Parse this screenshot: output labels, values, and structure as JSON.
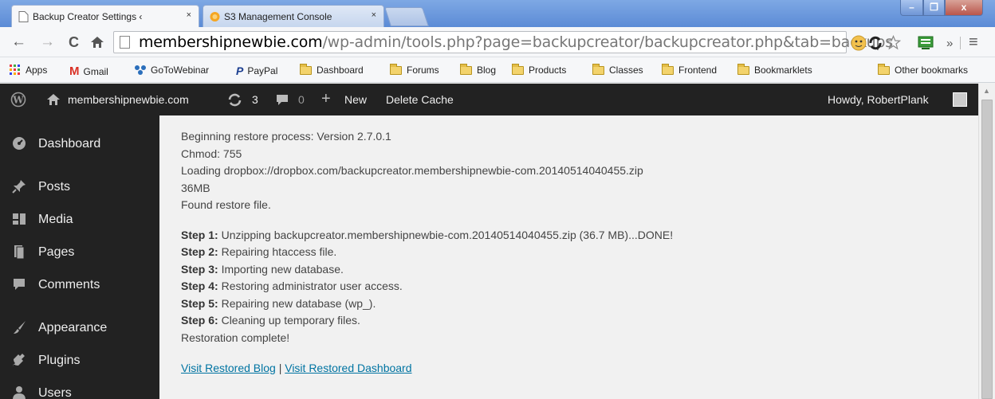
{
  "browser": {
    "tabs": [
      {
        "title": "Backup Creator Settings ‹",
        "close": "×"
      },
      {
        "title": "S3 Management Console",
        "close": "×"
      }
    ],
    "window_buttons": {
      "minimize": "–",
      "maximize": "❐",
      "close": "x"
    },
    "nav": {
      "back": "←",
      "forward": "→",
      "reload": "C",
      "home": "🏠"
    },
    "url": {
      "domain": "membershipnewbie.com",
      "path": "/wp-admin/tools.php?page=backupcreator/backupcreator.php&tab=backups"
    },
    "toolbar_right": {
      "overflow": "»",
      "menu": "≡"
    },
    "bookmarks": [
      {
        "label": "Apps",
        "icon": "apps-grid-icon"
      },
      {
        "label": "Gmail",
        "icon": "gmail-icon"
      },
      {
        "label": "GoToWebinar",
        "icon": "gotowebinar-icon"
      },
      {
        "label": "PayPal",
        "icon": "paypal-icon"
      },
      {
        "label": "Dashboard",
        "icon": "folder-icon"
      },
      {
        "label": "Forums",
        "icon": "folder-icon"
      },
      {
        "label": "Blog",
        "icon": "folder-icon"
      },
      {
        "label": "Products",
        "icon": "folder-icon"
      },
      {
        "label": "Classes",
        "icon": "folder-icon"
      },
      {
        "label": "Frontend",
        "icon": "folder-icon"
      },
      {
        "label": "Bookmarklets",
        "icon": "folder-icon"
      }
    ],
    "other_bookmarks": "Other bookmarks"
  },
  "adminbar": {
    "site": "membershipnewbie.com",
    "updates": "3",
    "comments": "0",
    "new": "New",
    "delete_cache": "Delete Cache",
    "howdy": "Howdy, RobertPlank"
  },
  "sidebar": {
    "items": [
      {
        "label": "Dashboard",
        "icon": "dashboard-icon"
      },
      {
        "label": "Posts",
        "icon": "pin-icon"
      },
      {
        "label": "Media",
        "icon": "media-icon"
      },
      {
        "label": "Pages",
        "icon": "pages-icon"
      },
      {
        "label": "Comments",
        "icon": "comment-icon"
      },
      {
        "label": "Appearance",
        "icon": "brush-icon"
      },
      {
        "label": "Plugins",
        "icon": "plugin-icon"
      },
      {
        "label": "Users",
        "icon": "users-icon"
      }
    ]
  },
  "log": {
    "intro": [
      "Beginning restore process: Version 2.7.0.1",
      "Chmod: 755",
      "Loading dropbox://dropbox.com/backupcreator.membershipnewbie-com.20140514040455.zip",
      "36MB",
      "Found restore file."
    ],
    "steps": [
      {
        "label": "Step 1:",
        "text": " Unzipping backupcreator.membershipnewbie-com.20140514040455.zip (36.7 MB)...DONE!"
      },
      {
        "label": "Step 2:",
        "text": " Repairing htaccess file."
      },
      {
        "label": "Step 3:",
        "text": " Importing new database."
      },
      {
        "label": "Step 4:",
        "text": " Restoring administrator user access."
      },
      {
        "label": "Step 5:",
        "text": " Repairing new database (wp_)."
      },
      {
        "label": "Step 6:",
        "text": " Cleaning up temporary files."
      }
    ],
    "complete": "Restoration complete!",
    "link_blog": "Visit Restored Blog",
    "separator": " | ",
    "link_dashboard": "Visit Restored Dashboard"
  },
  "colors": {
    "link": "#0074a2",
    "adminbar": "#222222",
    "content_bg": "#f1f1f1"
  }
}
